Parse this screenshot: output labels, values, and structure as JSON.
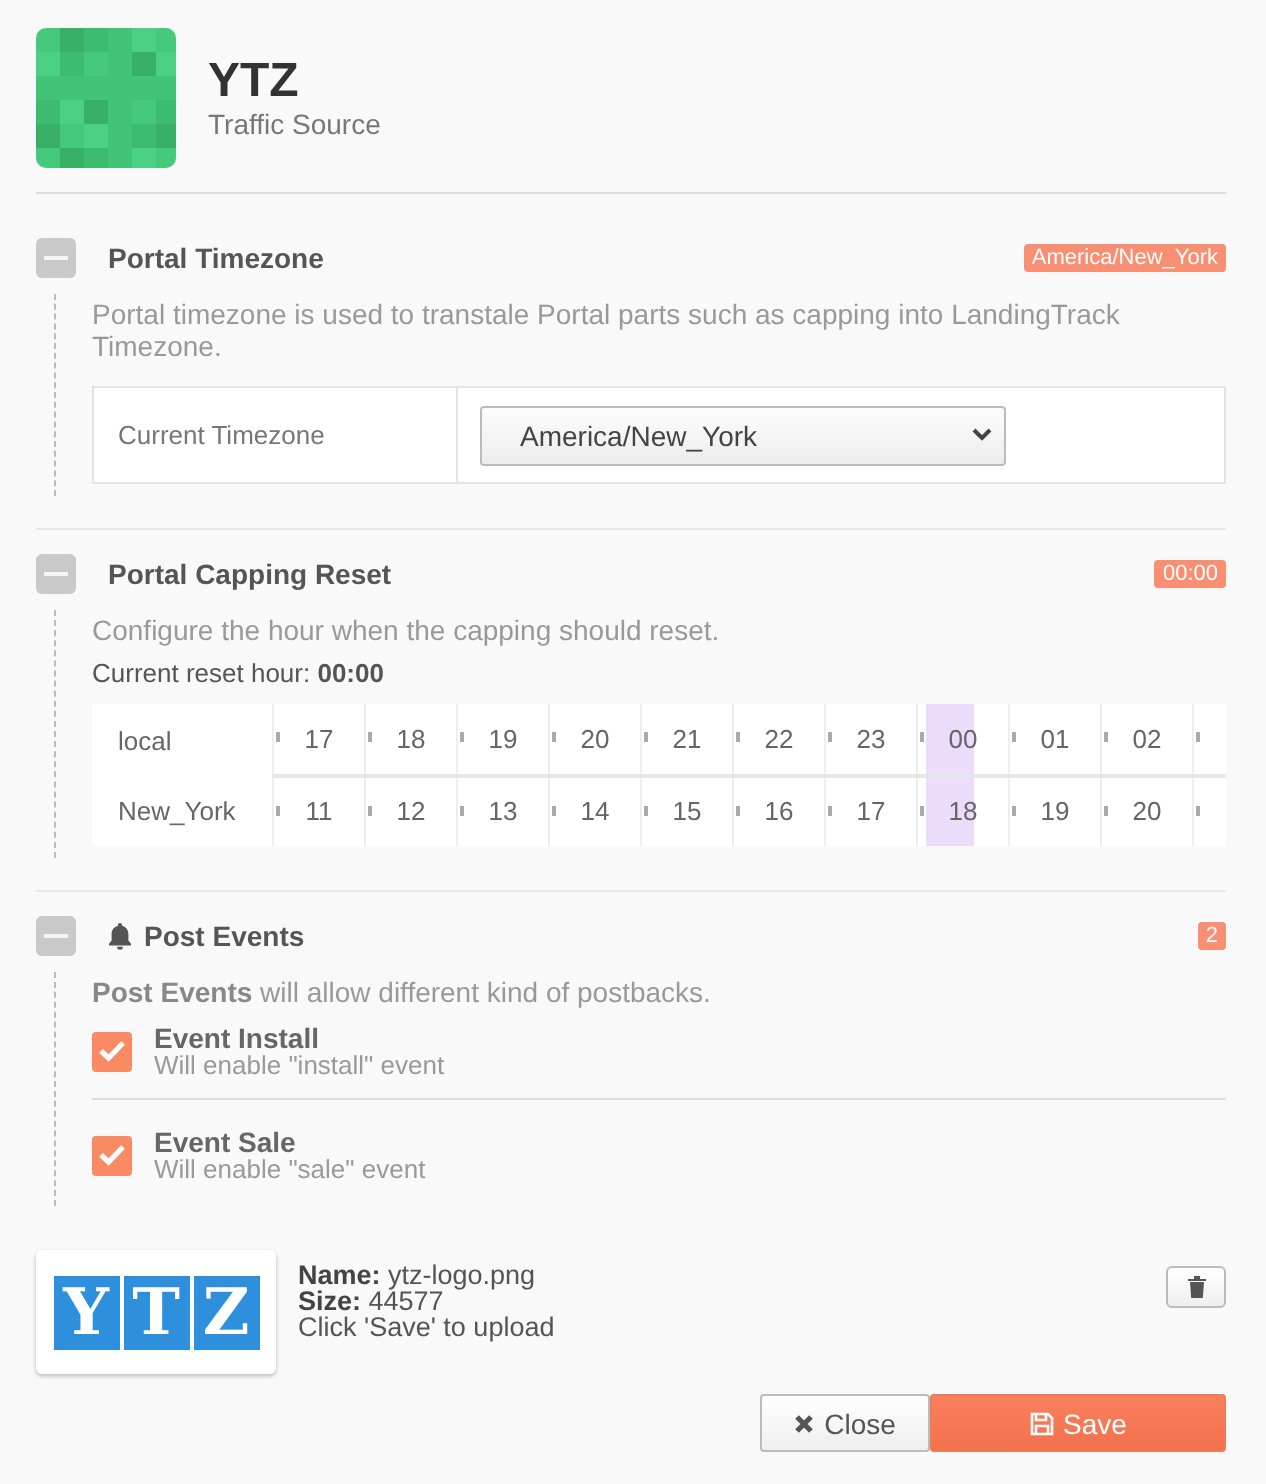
{
  "header": {
    "title": "YTZ",
    "subtitle": "Traffic Source"
  },
  "sections": [
    {
      "kind": "timezone",
      "title": "Portal Timezone",
      "expanded": true,
      "badge": "America/New_York",
      "description": "Portal timezone is used to transtale Portal parts such as capping into LandingTrack Timezone.",
      "field_label": "Current Timezone",
      "select_value": "America/New_York"
    },
    {
      "kind": "capping",
      "title": "Portal Capping Reset",
      "expanded": true,
      "badge": "00:00",
      "description": "Configure the hour when the capping should reset.",
      "current_label": "Current reset hour: **00:00**",
      "row_labels": [
        "local",
        "New_York"
      ],
      "hours": [
        {
          "local": "17",
          "remote": "11",
          "selected": false
        },
        {
          "local": "18",
          "remote": "12",
          "selected": false
        },
        {
          "local": "19",
          "remote": "13",
          "selected": false
        },
        {
          "local": "20",
          "remote": "14",
          "selected": false
        },
        {
          "local": "21",
          "remote": "15",
          "selected": false
        },
        {
          "local": "22",
          "remote": "16",
          "selected": false
        },
        {
          "local": "23",
          "remote": "17",
          "selected": false
        },
        {
          "local": "00",
          "remote": "18",
          "selected": true
        },
        {
          "local": "01",
          "remote": "19",
          "selected": false
        },
        {
          "local": "02",
          "remote": "20",
          "selected": false
        }
      ]
    },
    {
      "kind": "events",
      "title": "Post Events",
      "expanded": true,
      "badge": "2",
      "description": "**Post Events** will allow different kind of postbacks.",
      "events": [
        {
          "title": "Event Install",
          "subtitle": "Will enable \"install\" event",
          "checked": true
        },
        {
          "title": "Event Sale",
          "subtitle": "Will enable \"sale\" event",
          "checked": true
        }
      ]
    }
  ],
  "upload": {
    "logo_letters": [
      "Y",
      "T",
      "Z"
    ],
    "name_label": "Name:",
    "name": "ytz-logo.png",
    "size_label": "Size:",
    "size": "44577",
    "hint": "Click 'Save' to upload"
  },
  "buttons": [
    {
      "kind": "close",
      "label": "Close"
    },
    {
      "kind": "save",
      "label": "Save"
    }
  ]
}
